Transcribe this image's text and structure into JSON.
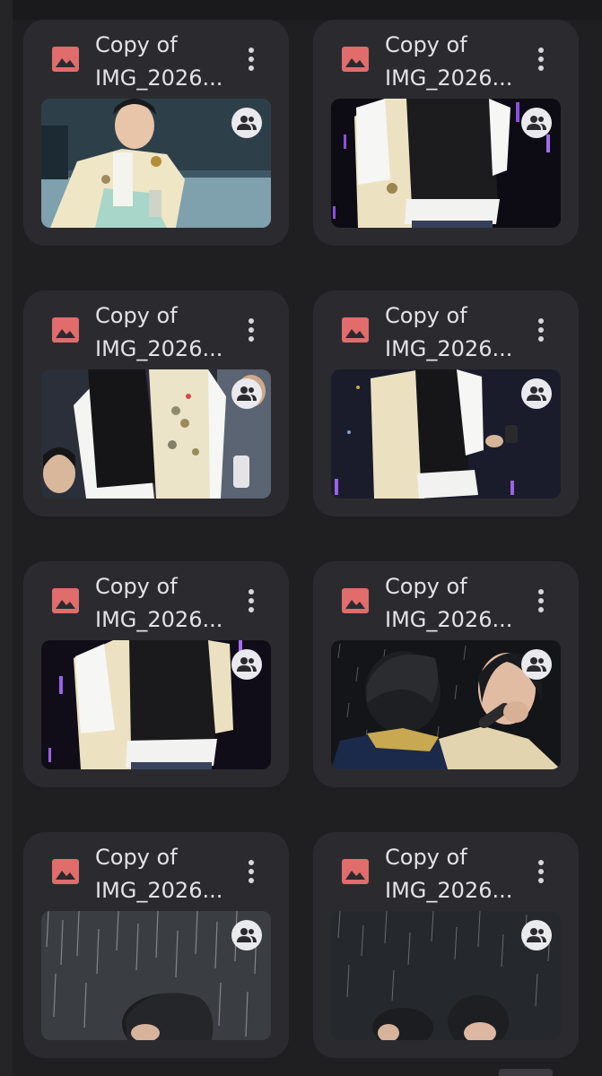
{
  "files": [
    {
      "title_line1": "Copy of",
      "title_line2": "IMG_2026...",
      "type_icon": "image-file-icon",
      "shared_icon": "shared-people-icon",
      "menu_icon": "more-vertical-icon"
    },
    {
      "title_line1": "Copy of",
      "title_line2": "IMG_2026...",
      "type_icon": "image-file-icon",
      "shared_icon": "shared-people-icon",
      "menu_icon": "more-vertical-icon"
    },
    {
      "title_line1": "Copy of",
      "title_line2": "IMG_2026...",
      "type_icon": "image-file-icon",
      "shared_icon": "shared-people-icon",
      "menu_icon": "more-vertical-icon"
    },
    {
      "title_line1": "Copy of",
      "title_line2": "IMG_2026...",
      "type_icon": "image-file-icon",
      "shared_icon": "shared-people-icon",
      "menu_icon": "more-vertical-icon"
    },
    {
      "title_line1": "Copy of",
      "title_line2": "IMG_2026...",
      "type_icon": "image-file-icon",
      "shared_icon": "shared-people-icon",
      "menu_icon": "more-vertical-icon"
    },
    {
      "title_line1": "Copy of",
      "title_line2": "IMG_2026...",
      "type_icon": "image-file-icon",
      "shared_icon": "shared-people-icon",
      "menu_icon": "more-vertical-icon"
    },
    {
      "title_line1": "Copy of",
      "title_line2": "IMG_2026...",
      "type_icon": "image-file-icon",
      "shared_icon": "shared-people-icon",
      "menu_icon": "more-vertical-icon"
    },
    {
      "title_line1": "Copy of",
      "title_line2": "IMG_2026...",
      "type_icon": "image-file-icon",
      "shared_icon": "shared-people-icon",
      "menu_icon": "more-vertical-icon"
    }
  ],
  "colors": {
    "background": "#1f1f22",
    "card": "#2b2b2f",
    "title_text": "#e3e3e6",
    "image_icon": "#e06c6c",
    "badge": "#e9e9ee"
  }
}
